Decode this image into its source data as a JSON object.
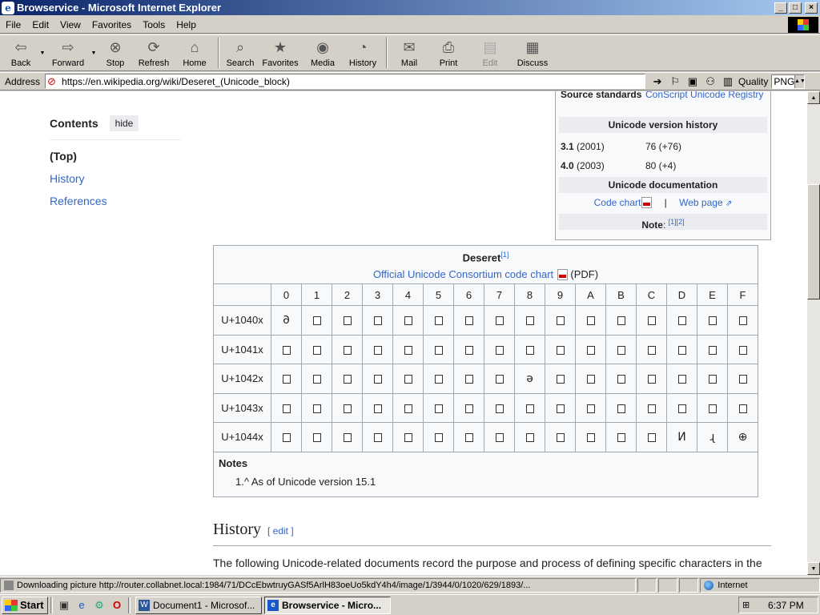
{
  "window": {
    "title": "Browservice - Microsoft Internet Explorer",
    "controls": [
      "_",
      "□",
      "×"
    ]
  },
  "menu": [
    {
      "label": "File"
    },
    {
      "label": "Edit"
    },
    {
      "label": "View"
    },
    {
      "label": "Favorites"
    },
    {
      "label": "Tools"
    },
    {
      "label": "Help"
    }
  ],
  "toolbar": {
    "back": "Back",
    "forward": "Forward",
    "stop": "Stop",
    "refresh": "Refresh",
    "home": "Home",
    "search": "Search",
    "favorites": "Favorites",
    "media": "Media",
    "history": "History",
    "mail": "Mail",
    "print": "Print",
    "edit": "Edit",
    "discuss": "Discuss"
  },
  "address": {
    "label": "Address",
    "url": "https://en.wikipedia.org/wiki/Deseret_(Unicode_block)",
    "quality_label": "Quality",
    "quality_value": "PNG"
  },
  "toc": {
    "title": "Contents",
    "hide": "hide",
    "items": [
      "(Top)",
      "History",
      "References"
    ]
  },
  "infobox": {
    "source_key": "Source standards",
    "source_val": "ConScript Unicode Registry",
    "version_history_title": "Unicode version history",
    "versions": [
      {
        "version": "3.1",
        "year": "(2001)",
        "count": "76 (+76)"
      },
      {
        "version": "4.0",
        "year": "(2003)",
        "count": "80 (+4)"
      }
    ],
    "documentation_title": "Unicode documentation",
    "code_chart": "Code chart",
    "separator": "|",
    "web_page": "Web page",
    "note_label": "Note",
    "note_refs": "[1][2]"
  },
  "table": {
    "title": "Deseret",
    "title_ref": "[1]",
    "chart_link": "Official Unicode Consortium code chart",
    "pdf_label": "(PDF)",
    "columns": [
      "0",
      "1",
      "2",
      "3",
      "4",
      "5",
      "6",
      "7",
      "8",
      "9",
      "A",
      "B",
      "C",
      "D",
      "E",
      "F"
    ],
    "rows": [
      {
        "label": "U+1040x",
        "cells": [
          "𐐀",
          "",
          "",
          "",
          "",
          "",
          "",
          "",
          "",
          "",
          "",
          "",
          "",
          "",
          "",
          ""
        ]
      },
      {
        "label": "U+1041x",
        "cells": [
          "",
          "",
          "",
          "",
          "",
          "",
          "",
          "",
          "",
          "",
          "",
          "",
          "",
          "",
          "",
          ""
        ]
      },
      {
        "label": "U+1042x",
        "cells": [
          "",
          "",
          "",
          "",
          "",
          "",
          "",
          "",
          "ə",
          "",
          "",
          "",
          "",
          "",
          "",
          ""
        ]
      },
      {
        "label": "U+1043x",
        "cells": [
          "",
          "",
          "",
          "",
          "",
          "",
          "",
          "",
          "",
          "",
          "",
          "",
          "",
          "",
          "",
          ""
        ]
      },
      {
        "label": "U+1044x",
        "cells": [
          "",
          "",
          "",
          "",
          "",
          "",
          "",
          "",
          "",
          "",
          "",
          "",
          "",
          "И",
          "ɻ",
          "⊕"
        ]
      }
    ],
    "notes_title": "Notes",
    "note_1": "1.^ As of Unicode version 15.1"
  },
  "history": {
    "heading": "History",
    "edit": "[ edit ]",
    "text": "The following Unicode-related documents record the purpose and process of defining specific characters in the Deseret block:"
  },
  "status": {
    "text": "Downloading picture http://router.collabnet.local:1984/71/DCcEbwtruyGASf5ArlH83oeUo5kdY4h4/image/1/3944/0/1020/629/1893/...",
    "zone": "Internet"
  },
  "taskbar": {
    "start": "Start",
    "tasks": [
      {
        "label": "Document1 - Microsof...",
        "active": false
      },
      {
        "label": "Browservice - Micro...",
        "active": true
      }
    ],
    "clock": "6:37 PM"
  }
}
